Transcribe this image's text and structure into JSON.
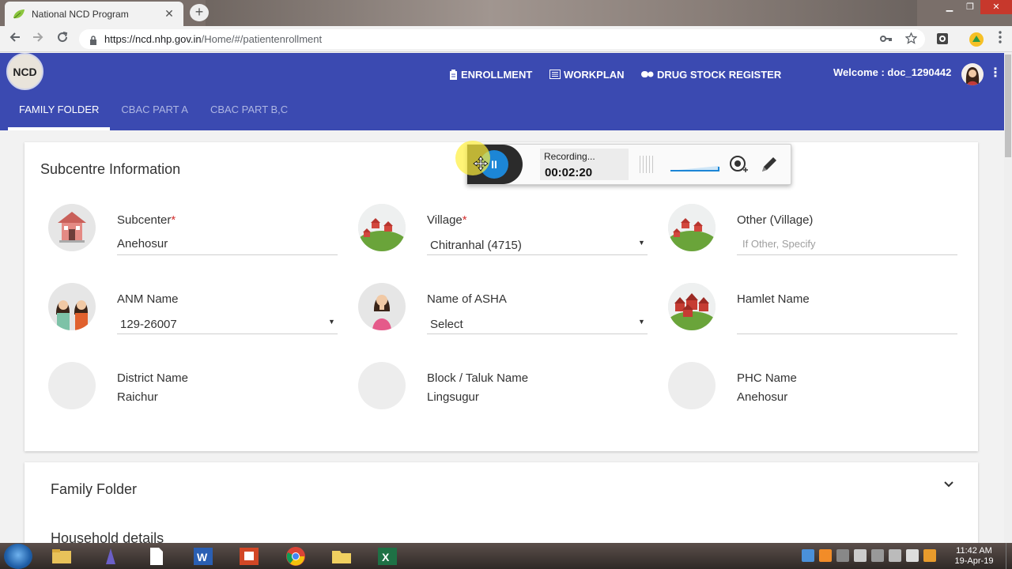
{
  "browser": {
    "tab_title": "National NCD Program",
    "tab_close": "✕",
    "new_tab": "+",
    "url_host": "https://ncd.nhp.gov.in",
    "url_path": "/Home/#/patientenrollment",
    "window_controls": [
      "▁",
      "❐",
      "✕"
    ]
  },
  "app": {
    "logo_text": "NCD",
    "nav": [
      {
        "label": "ENROLLMENT",
        "icon": "clipboard-icon"
      },
      {
        "label": "WORKPLAN",
        "icon": "list-icon"
      },
      {
        "label": "DRUG STOCK REGISTER",
        "icon": "pills-icon"
      }
    ],
    "welcome": "Welcome : doc_1290442",
    "subtabs": [
      {
        "label": "FAMILY FOLDER",
        "active": true
      },
      {
        "label": "CBAC PART A",
        "active": false
      },
      {
        "label": "CBAC PART B,C",
        "active": false
      }
    ]
  },
  "subcentre": {
    "title": "Subcentre Information",
    "fields": {
      "subcenter": {
        "label": "Subcenter",
        "required": "*",
        "value": "Anehosur"
      },
      "village": {
        "label": "Village",
        "required": "*",
        "value": "Chitranhal (4715)"
      },
      "other_village": {
        "label": "Other (Village)",
        "placeholder": "If Other, Specify"
      },
      "anm": {
        "label": "ANM Name",
        "value": "129-26007"
      },
      "asha": {
        "label": "Name of ASHA",
        "value": "Select"
      },
      "hamlet": {
        "label": "Hamlet Name",
        "value": ""
      },
      "district": {
        "label": "District Name",
        "value": "Raichur"
      },
      "block": {
        "label": "Block / Taluk Name",
        "value": "Lingsugur"
      },
      "phc": {
        "label": "PHC Name",
        "value": "Anehosur"
      }
    },
    "caret": "▼"
  },
  "family_folder": {
    "title": "Family Folder",
    "chevron": "⌄",
    "household_title": "Household details"
  },
  "recorder": {
    "status": "Recording...",
    "time": "00:02:20",
    "pause": "II"
  },
  "taskbar": {
    "time": "11:42 AM",
    "date": "19-Apr-19"
  },
  "colors": {
    "appbar": "#3b4ab1",
    "required": "#d32f2f",
    "recorder_button": "#1c86d6"
  }
}
